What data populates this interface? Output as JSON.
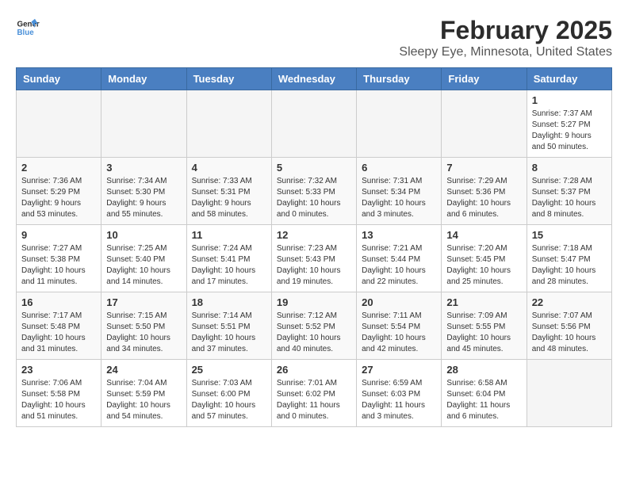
{
  "logo": {
    "line1": "General",
    "line2": "Blue"
  },
  "title": "February 2025",
  "subtitle": "Sleepy Eye, Minnesota, United States",
  "days_of_week": [
    "Sunday",
    "Monday",
    "Tuesday",
    "Wednesday",
    "Thursday",
    "Friday",
    "Saturday"
  ],
  "weeks": [
    [
      {
        "day": "",
        "info": ""
      },
      {
        "day": "",
        "info": ""
      },
      {
        "day": "",
        "info": ""
      },
      {
        "day": "",
        "info": ""
      },
      {
        "day": "",
        "info": ""
      },
      {
        "day": "",
        "info": ""
      },
      {
        "day": "1",
        "info": "Sunrise: 7:37 AM\nSunset: 5:27 PM\nDaylight: 9 hours and 50 minutes."
      }
    ],
    [
      {
        "day": "2",
        "info": "Sunrise: 7:36 AM\nSunset: 5:29 PM\nDaylight: 9 hours and 53 minutes."
      },
      {
        "day": "3",
        "info": "Sunrise: 7:34 AM\nSunset: 5:30 PM\nDaylight: 9 hours and 55 minutes."
      },
      {
        "day": "4",
        "info": "Sunrise: 7:33 AM\nSunset: 5:31 PM\nDaylight: 9 hours and 58 minutes."
      },
      {
        "day": "5",
        "info": "Sunrise: 7:32 AM\nSunset: 5:33 PM\nDaylight: 10 hours and 0 minutes."
      },
      {
        "day": "6",
        "info": "Sunrise: 7:31 AM\nSunset: 5:34 PM\nDaylight: 10 hours and 3 minutes."
      },
      {
        "day": "7",
        "info": "Sunrise: 7:29 AM\nSunset: 5:36 PM\nDaylight: 10 hours and 6 minutes."
      },
      {
        "day": "8",
        "info": "Sunrise: 7:28 AM\nSunset: 5:37 PM\nDaylight: 10 hours and 8 minutes."
      }
    ],
    [
      {
        "day": "9",
        "info": "Sunrise: 7:27 AM\nSunset: 5:38 PM\nDaylight: 10 hours and 11 minutes."
      },
      {
        "day": "10",
        "info": "Sunrise: 7:25 AM\nSunset: 5:40 PM\nDaylight: 10 hours and 14 minutes."
      },
      {
        "day": "11",
        "info": "Sunrise: 7:24 AM\nSunset: 5:41 PM\nDaylight: 10 hours and 17 minutes."
      },
      {
        "day": "12",
        "info": "Sunrise: 7:23 AM\nSunset: 5:43 PM\nDaylight: 10 hours and 19 minutes."
      },
      {
        "day": "13",
        "info": "Sunrise: 7:21 AM\nSunset: 5:44 PM\nDaylight: 10 hours and 22 minutes."
      },
      {
        "day": "14",
        "info": "Sunrise: 7:20 AM\nSunset: 5:45 PM\nDaylight: 10 hours and 25 minutes."
      },
      {
        "day": "15",
        "info": "Sunrise: 7:18 AM\nSunset: 5:47 PM\nDaylight: 10 hours and 28 minutes."
      }
    ],
    [
      {
        "day": "16",
        "info": "Sunrise: 7:17 AM\nSunset: 5:48 PM\nDaylight: 10 hours and 31 minutes."
      },
      {
        "day": "17",
        "info": "Sunrise: 7:15 AM\nSunset: 5:50 PM\nDaylight: 10 hours and 34 minutes."
      },
      {
        "day": "18",
        "info": "Sunrise: 7:14 AM\nSunset: 5:51 PM\nDaylight: 10 hours and 37 minutes."
      },
      {
        "day": "19",
        "info": "Sunrise: 7:12 AM\nSunset: 5:52 PM\nDaylight: 10 hours and 40 minutes."
      },
      {
        "day": "20",
        "info": "Sunrise: 7:11 AM\nSunset: 5:54 PM\nDaylight: 10 hours and 42 minutes."
      },
      {
        "day": "21",
        "info": "Sunrise: 7:09 AM\nSunset: 5:55 PM\nDaylight: 10 hours and 45 minutes."
      },
      {
        "day": "22",
        "info": "Sunrise: 7:07 AM\nSunset: 5:56 PM\nDaylight: 10 hours and 48 minutes."
      }
    ],
    [
      {
        "day": "23",
        "info": "Sunrise: 7:06 AM\nSunset: 5:58 PM\nDaylight: 10 hours and 51 minutes."
      },
      {
        "day": "24",
        "info": "Sunrise: 7:04 AM\nSunset: 5:59 PM\nDaylight: 10 hours and 54 minutes."
      },
      {
        "day": "25",
        "info": "Sunrise: 7:03 AM\nSunset: 6:00 PM\nDaylight: 10 hours and 57 minutes."
      },
      {
        "day": "26",
        "info": "Sunrise: 7:01 AM\nSunset: 6:02 PM\nDaylight: 11 hours and 0 minutes."
      },
      {
        "day": "27",
        "info": "Sunrise: 6:59 AM\nSunset: 6:03 PM\nDaylight: 11 hours and 3 minutes."
      },
      {
        "day": "28",
        "info": "Sunrise: 6:58 AM\nSunset: 6:04 PM\nDaylight: 11 hours and 6 minutes."
      },
      {
        "day": "",
        "info": ""
      }
    ]
  ]
}
